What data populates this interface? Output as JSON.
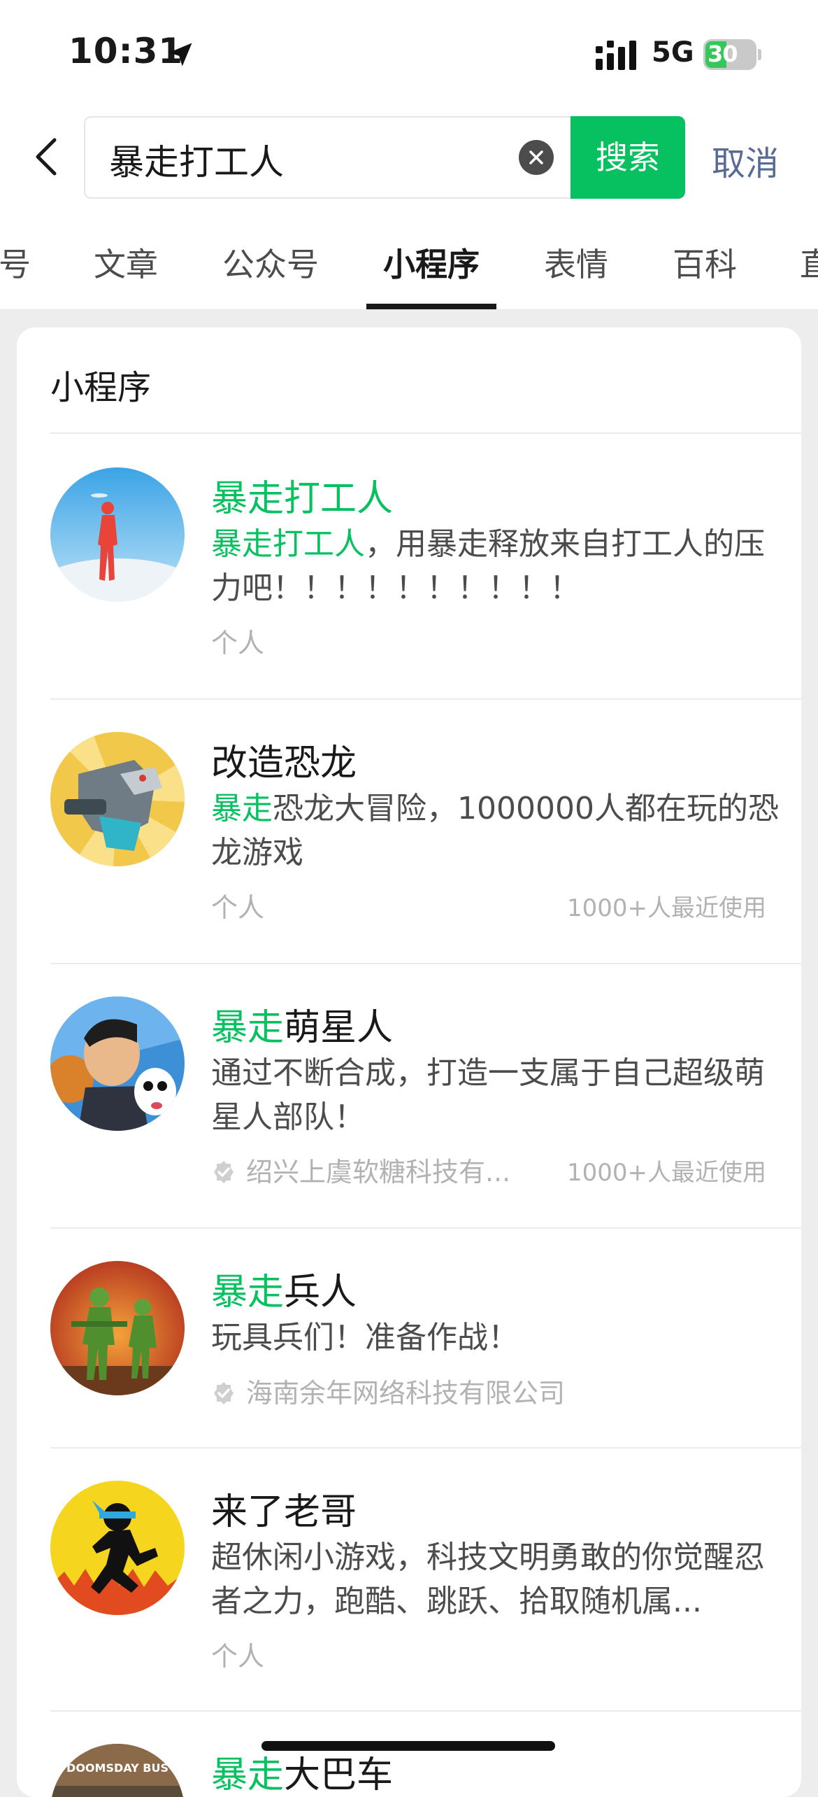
{
  "status_bar": {
    "time": "10:31",
    "network": "5G",
    "battery": "30"
  },
  "search": {
    "query": "暴走打工人",
    "button_label": "搜索",
    "cancel_label": "取消"
  },
  "tabs": [
    {
      "label": "号"
    },
    {
      "label": "文章"
    },
    {
      "label": "公众号"
    },
    {
      "label": "小程序",
      "active": true
    },
    {
      "label": "表情"
    },
    {
      "label": "百科"
    },
    {
      "label": "直"
    }
  ],
  "section": {
    "title": "小程序"
  },
  "results": [
    {
      "title_hl": "暴走打工人",
      "title_rest": "",
      "desc_hl": "暴走打工人",
      "desc_rest": "，用暴走释放来自打工人的压力吧！！！！！！！！！！",
      "meta": "个人",
      "usage": "",
      "verified": false,
      "avatar_icon": "red-runner-icon"
    },
    {
      "title_hl": "",
      "title_rest": "改造恐龙",
      "desc_hl": "暴走",
      "desc_rest": "恐龙大冒险，1000000人都在玩的恐龙游戏",
      "meta": "个人",
      "usage": "1000+人最近使用",
      "verified": false,
      "avatar_icon": "robot-dinosaur-icon"
    },
    {
      "title_hl": "暴走",
      "title_rest": "萌星人",
      "desc_hl": "",
      "desc_rest": "通过不断合成，打造一支属于自己超级萌星人部队！",
      "meta": "绍兴上虞软糖科技有...",
      "usage": "1000+人最近使用",
      "verified": true,
      "avatar_icon": "cartoon-man-with-panda-icon"
    },
    {
      "title_hl": "暴走",
      "title_rest": "兵人",
      "desc_hl": "",
      "desc_rest": "玩具兵们！准备作战！",
      "meta": "海南余年网络科技有限公司",
      "usage": "",
      "verified": true,
      "avatar_icon": "toy-soldiers-icon"
    },
    {
      "title_hl": "",
      "title_rest": "来了老哥",
      "desc_hl": "",
      "desc_rest": "超休闲小游戏，科技文明勇敢的你觉醒忍者之力，跑酷、跳跃、拾取随机属...",
      "meta": "个人",
      "usage": "",
      "verified": false,
      "avatar_icon": "ninja-runner-icon"
    },
    {
      "title_hl": "暴走",
      "title_rest": "大巴车",
      "desc_hl": "",
      "desc_rest": "",
      "meta": "",
      "usage": "",
      "verified": false,
      "avatar_icon": "doomsday-bus-icon",
      "avatar_caption": "DOOMSDAY BUS"
    }
  ],
  "colors": {
    "accent": "#07c160",
    "link": "#576b95"
  }
}
